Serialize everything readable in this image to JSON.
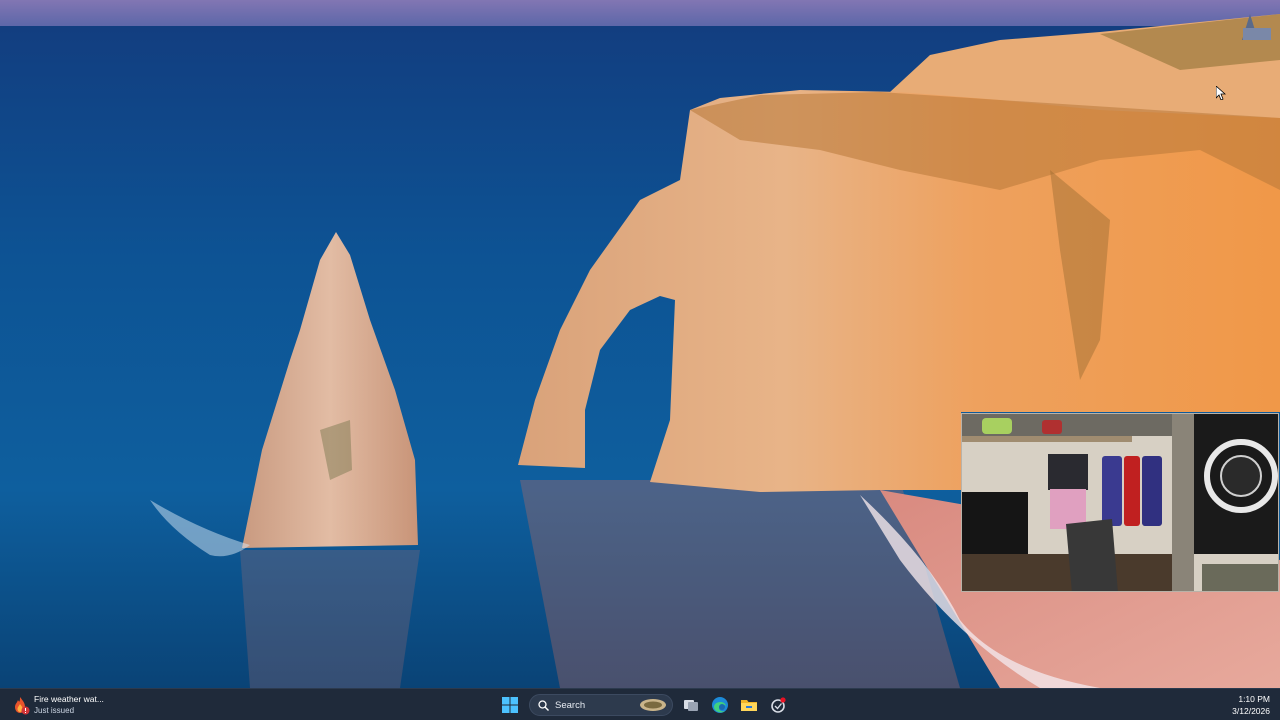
{
  "desktop": {
    "wallpaper_icon": "etretat-cliffs-wallpaper",
    "cursor_icon": "mouse-pointer-icon"
  },
  "webcam_overlay": {
    "icon": "webcam-feed"
  },
  "taskbar": {
    "notification": {
      "icon": "fire-weather-alert-icon",
      "title": "Fire weather wat...",
      "subtitle": "Just issued"
    },
    "start_icon": "windows-start-icon",
    "search": {
      "label": "Search",
      "icon": "search-icon"
    },
    "apps": [
      {
        "name": "task-view-icon"
      },
      {
        "name": "edge-browser-icon"
      },
      {
        "name": "file-explorer-icon"
      },
      {
        "name": "copilot-icon"
      }
    ],
    "clock": {
      "time": "1:10 PM",
      "date": "3/12/2026"
    },
    "colors": {
      "taskbar_bg": "#1f2a3a",
      "accent": "#0078d4"
    }
  }
}
